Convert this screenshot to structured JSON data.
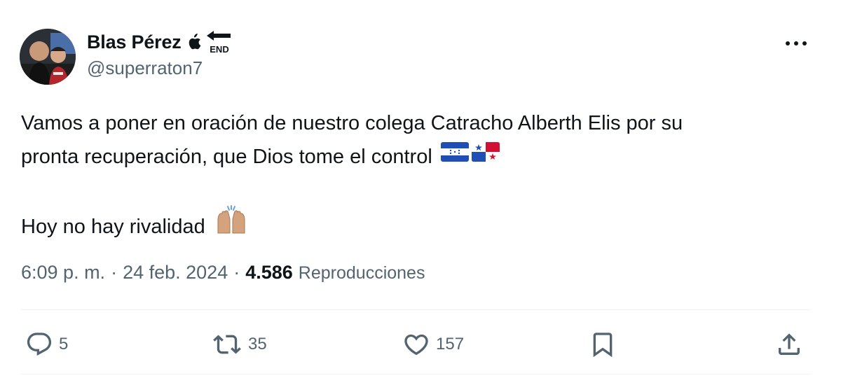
{
  "author": {
    "display_name": "Blas Pérez",
    "handle": "@superraton7",
    "badge_end_text": "END"
  },
  "tweet": {
    "line1": "Vamos a poner en oración de nuestro colega Catracho Alberth Elis por su",
    "line2": "pronta recuperación, que Dios tome el control",
    "line3": "Hoy no hay rivalidad"
  },
  "meta": {
    "time": "6:09 p. m.",
    "separator1": "·",
    "date": "24 feb. 2024",
    "separator2": "·",
    "views_count": "4.586",
    "views_label": "Reproducciones"
  },
  "actions": {
    "replies": "5",
    "reposts": "35",
    "likes": "157"
  },
  "icons": {
    "more": "more-dots-icon",
    "reply": "reply-icon",
    "repost": "repost-icon",
    "like": "heart-icon",
    "bookmark": "bookmark-icon",
    "share": "share-icon",
    "flag_honduras": "honduras-flag-icon",
    "flag_panama": "panama-flag-icon",
    "hands": "raised-hands-icon"
  },
  "colors": {
    "text_primary": "#0f1419",
    "text_secondary": "#536471",
    "divider": "#eff3f4"
  }
}
